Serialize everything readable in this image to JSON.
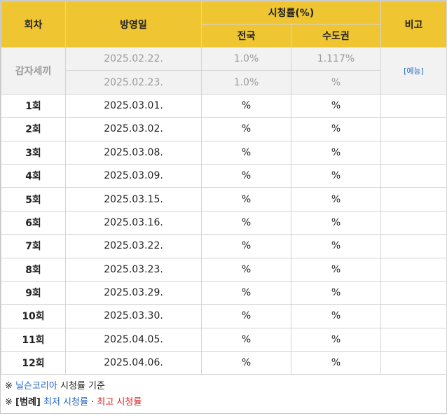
{
  "header": {
    "episode": "회차",
    "date": "방영일",
    "ratings": "시청률(%)",
    "nationwide": "전국",
    "capital": "수도권",
    "note": "비고"
  },
  "preview": {
    "label": "감자세끼",
    "tag": "[예능]",
    "rows": [
      {
        "date": "2025.02.22.",
        "nationwide": "1.0%",
        "capital": "1.117%"
      },
      {
        "date": "2025.02.23.",
        "nationwide": "1.0%",
        "capital": "%"
      }
    ]
  },
  "episodes": [
    {
      "ep": "1회",
      "date": "2025.03.01.",
      "nationwide": "%",
      "capital": "%",
      "note": ""
    },
    {
      "ep": "2회",
      "date": "2025.03.02.",
      "nationwide": "%",
      "capital": "%",
      "note": ""
    },
    {
      "ep": "3회",
      "date": "2025.03.08.",
      "nationwide": "%",
      "capital": "%",
      "note": ""
    },
    {
      "ep": "4회",
      "date": "2025.03.09.",
      "nationwide": "%",
      "capital": "%",
      "note": ""
    },
    {
      "ep": "5회",
      "date": "2025.03.15.",
      "nationwide": "%",
      "capital": "%",
      "note": ""
    },
    {
      "ep": "6회",
      "date": "2025.03.16.",
      "nationwide": "%",
      "capital": "%",
      "note": ""
    },
    {
      "ep": "7회",
      "date": "2025.03.22.",
      "nationwide": "%",
      "capital": "%",
      "note": ""
    },
    {
      "ep": "8회",
      "date": "2025.03.23.",
      "nationwide": "%",
      "capital": "%",
      "note": ""
    },
    {
      "ep": "9회",
      "date": "2025.03.29.",
      "nationwide": "%",
      "capital": "%",
      "note": ""
    },
    {
      "ep": "10회",
      "date": "2025.03.30.",
      "nationwide": "%",
      "capital": "%",
      "note": ""
    },
    {
      "ep": "11회",
      "date": "2025.04.05.",
      "nationwide": "%",
      "capital": "%",
      "note": ""
    },
    {
      "ep": "12회",
      "date": "2025.04.06.",
      "nationwide": "%",
      "capital": "%",
      "note": ""
    }
  ],
  "footer": {
    "mark": "※",
    "source_name": "닐슨코리아",
    "source_suffix": " 시청률 기준",
    "legend_label": "[범례]",
    "legend_low": "최저 시청률",
    "legend_sep": "·",
    "legend_high": "최고 시청률"
  },
  "colors": {
    "header_bg": "#efc632",
    "preview_bg": "#f2f2f2",
    "low": "#1f63c6",
    "high": "#d42020"
  }
}
